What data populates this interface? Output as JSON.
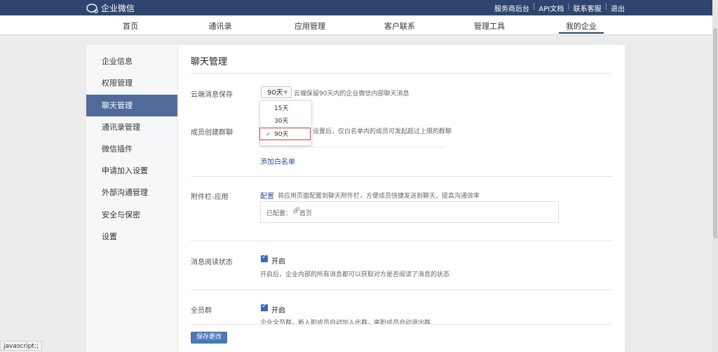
{
  "brand": {
    "name": "企业微信"
  },
  "top_links": [
    "服务商后台",
    "API文档",
    "联系客服",
    "退出"
  ],
  "nav": {
    "tabs": [
      "首页",
      "通讯录",
      "应用管理",
      "客户联系",
      "管理工具",
      "我的企业"
    ],
    "active": "我的企业"
  },
  "sidebar": {
    "items": [
      "企业信息",
      "权限管理",
      "聊天管理",
      "通讯录管理",
      "微信插件",
      "申请加入设置",
      "外部沟通管理",
      "安全与保密",
      "设置"
    ],
    "active": "聊天管理"
  },
  "page": {
    "title": "聊天管理"
  },
  "cloud_storage": {
    "label": "云端消息保存",
    "selected": "90天",
    "hint": "云端保留90天内的企业微信内部聊天消息",
    "options": [
      "15天",
      "30天",
      "90天"
    ]
  },
  "group_create": {
    "label": "成员创建群聊",
    "hint_partial": "设置后，仅白名单内的成员可发起超过上限的群聊",
    "add_whitelist": "添加白名单"
  },
  "attachment": {
    "label": "附件栏-应用",
    "config_link": "配置",
    "hint": "将应用页面配置到聊天附件栏，方便成员快捷发送到聊天，提高沟通效率",
    "configured_label": "已配置：",
    "configured_item": "首页"
  },
  "read_status": {
    "label": "消息阅读状态",
    "toggle_label": "开启",
    "checked": true,
    "desc": "开启后，企业内部的所有消息都可以获取对方是否阅读了消息的状态"
  },
  "all_member_group": {
    "label": "全员群",
    "toggle_label": "开启",
    "checked": true,
    "desc": "企业全员群，新入职成员自动加入此群，离职成员自动退出群"
  },
  "save_button": "保存更改",
  "statusbar": "javascript:;",
  "colors": {
    "topbar": "#2e4570",
    "sidebar_active": "#506a9a",
    "button": "#4a78b8",
    "highlight_border": "#d23b3b"
  }
}
